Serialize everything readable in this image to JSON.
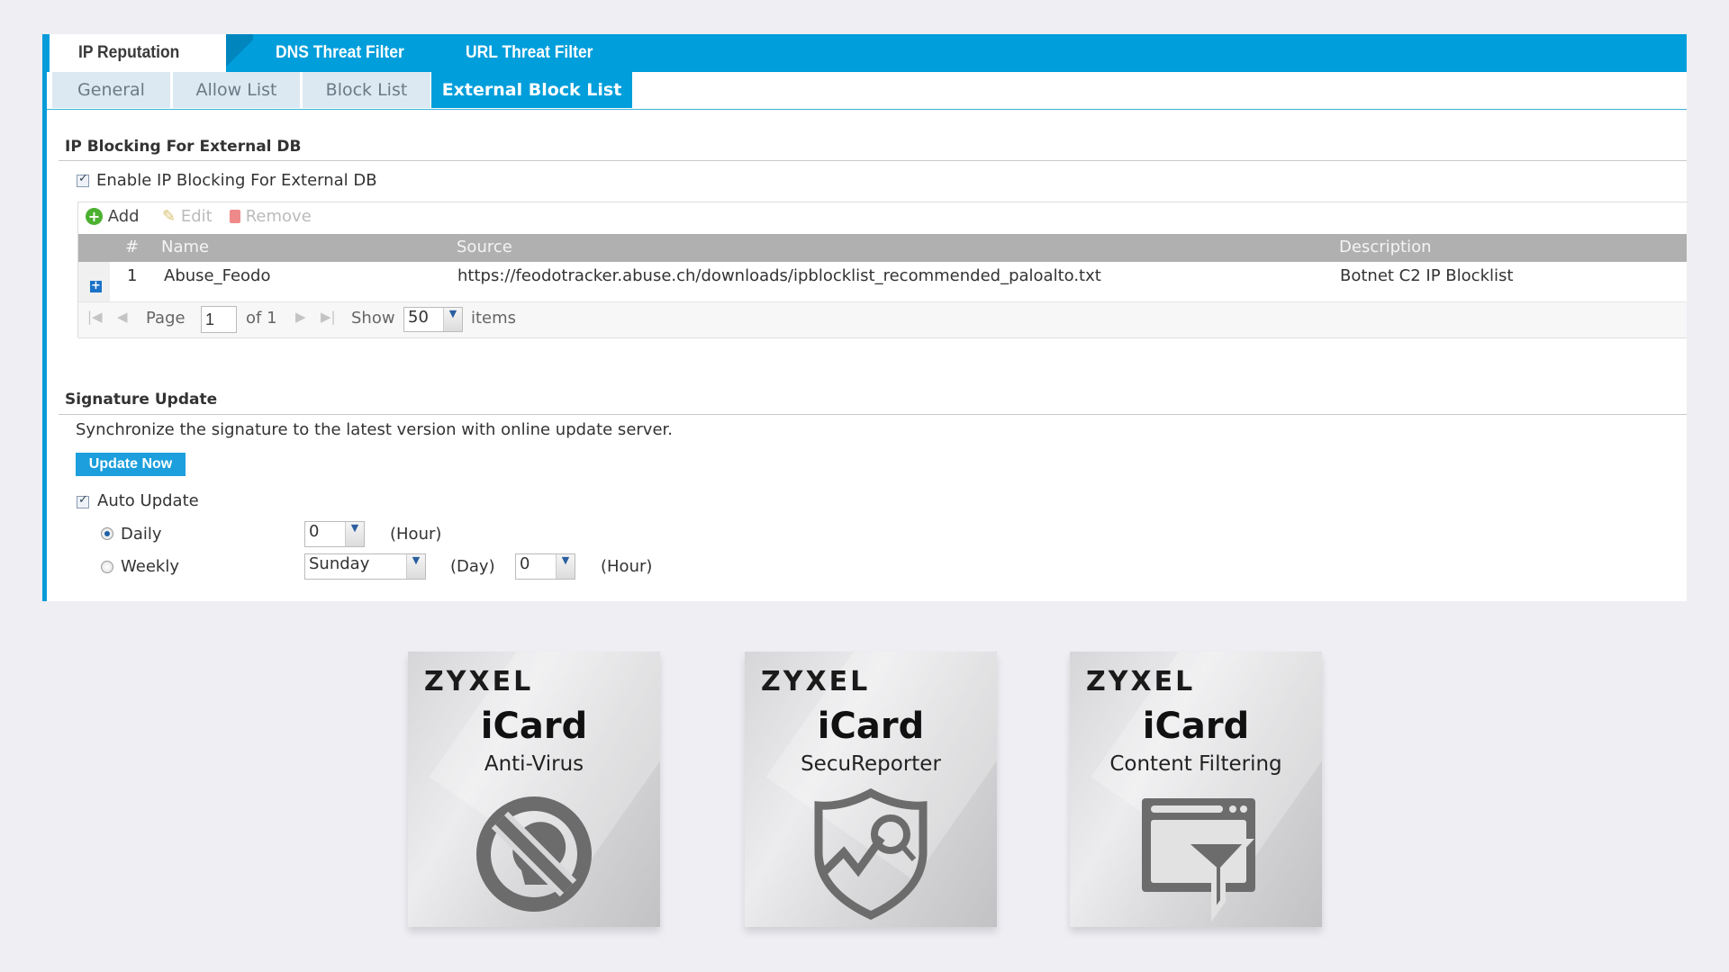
{
  "tabs": {
    "main": [
      {
        "label": "IP Reputation",
        "active": true
      },
      {
        "label": "DNS Threat Filter",
        "active": false
      },
      {
        "label": "URL Threat Filter",
        "active": false
      }
    ],
    "sub": [
      {
        "label": "General",
        "active": false
      },
      {
        "label": "Allow List",
        "active": false
      },
      {
        "label": "Block List",
        "active": false
      },
      {
        "label": "External Block List",
        "active": true
      }
    ]
  },
  "external_db": {
    "title": "IP Blocking For External DB",
    "enable_label": "Enable IP Blocking For External DB",
    "enable_checked": true,
    "toolbar": {
      "add": "Add",
      "edit": "Edit",
      "remove": "Remove"
    },
    "columns": [
      "#",
      "Name",
      "Source",
      "Description"
    ],
    "rows": [
      {
        "index": "1",
        "name": "Abuse_Feodo",
        "source": "https://feodotracker.abuse.ch/downloads/ipblocklist_recommended_paloalto.txt",
        "description": "Botnet C2 IP Blocklist"
      }
    ],
    "pager": {
      "page_label": "Page",
      "page_value": "1",
      "of_label": "of 1",
      "show_label": "Show",
      "show_value": "50",
      "items_label": "items"
    }
  },
  "signature": {
    "title": "Signature Update",
    "description": "Synchronize the signature to the latest version with online update server.",
    "update_button": "Update Now",
    "auto_update_label": "Auto Update",
    "auto_update_checked": true,
    "daily_label": "Daily",
    "daily_selected": true,
    "daily_hour": "0",
    "hour_label": "(Hour)",
    "weekly_label": "Weekly",
    "weekly_day": "Sunday",
    "day_label": "(Day)",
    "weekly_hour": "0"
  },
  "cards": [
    {
      "brand": "ZYXEL",
      "product": "iCard",
      "subtitle": "Anti-Virus",
      "icon": "no-virus-icon"
    },
    {
      "brand": "ZYXEL",
      "product": "iCard",
      "subtitle": "SecuReporter",
      "icon": "shield-analytics-icon"
    },
    {
      "brand": "ZYXEL",
      "product": "iCard",
      "subtitle": "Content Filtering",
      "icon": "browser-filter-icon"
    }
  ],
  "colors": {
    "accent": "#009edb",
    "header_gray": "#b0b0b0",
    "subtab_bg": "#dce9f2",
    "page_bg": "#eeeef3"
  }
}
